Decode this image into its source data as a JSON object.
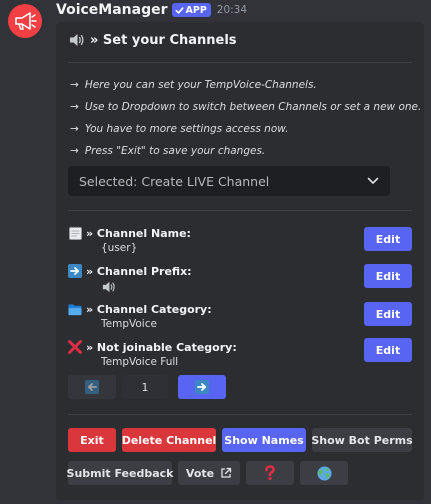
{
  "message": {
    "username": "VoiceManager",
    "badge": "APP",
    "timestamp": "20:34"
  },
  "embed": {
    "title": "» Set your Channels",
    "info_lines": [
      "Here you can set your TempVoice-Channels.",
      "Use to Dropdown to switch between Channels or set a new one.",
      "You have to more settings access now.",
      "Press \"Exit\" to save your changes."
    ],
    "dropdown": {
      "selected": "Selected: Create LIVE Channel"
    },
    "fields": [
      {
        "name": "» Channel Name:",
        "value": "{user}",
        "icon": "notepad-icon",
        "edit_label": "Edit"
      },
      {
        "name": "» Channel Prefix:",
        "value": "",
        "icon": "right-arrow-emoji-icon",
        "value_icon": "speaker-icon",
        "edit_label": "Edit"
      },
      {
        "name": "» Channel Category:",
        "value": "TempVoice",
        "icon": "folder-icon",
        "edit_label": "Edit"
      },
      {
        "name": "» Not joinable Category:",
        "value": "TempVoice Full",
        "icon": "cross-mark-icon",
        "edit_label": "Edit"
      }
    ],
    "pagination": {
      "page": "1"
    }
  },
  "buttons": {
    "exit": "Exit",
    "delete_channel": "Delete Channel",
    "show_names": "Show Names",
    "show_bot_perms": "Show Bot Perms",
    "submit_feedback": "Submit Feedback",
    "vote": "Vote"
  },
  "colors": {
    "background": "#313338",
    "embed": "#2b2d31",
    "blurple": "#5865f2",
    "danger": "#da373c",
    "secondary": "#3c3e44"
  }
}
